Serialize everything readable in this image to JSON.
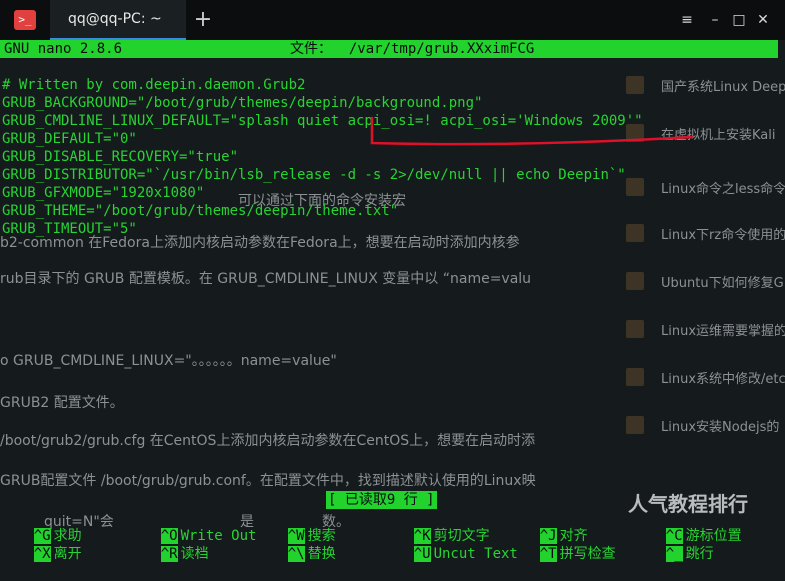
{
  "window": {
    "tab_title": "qq@qq-PC: ~",
    "new_tab_symbol": "+",
    "icons": [
      "terminal-icon",
      "new-tab-icon",
      "menu-icon",
      "minimize-icon",
      "maximize-icon",
      "close-icon"
    ],
    "controls": {
      "menu": "≡",
      "minimize": "–",
      "maximize": "□",
      "close": "✕"
    }
  },
  "nano": {
    "version": "GNU nano 2.8.6",
    "file_label": "文件：  /var/tmp/grub.XXximFCG",
    "lines": [
      "# Written by com.deepin.daemon.Grub2",
      "GRUB_BACKGROUND=\"/boot/grub/themes/deepin/background.png\"",
      "GRUB_CMDLINE_LINUX_DEFAULT=\"splash quiet acpi_osi=! acpi_osi='Windows 2009'\"",
      "GRUB_DEFAULT=\"0\"",
      "GRUB_DISABLE_RECOVERY=\"true\"",
      "GRUB_DISTRIBUTOR=\"`/usr/bin/lsb_release -d -s 2>/dev/null || echo Deepin`\"",
      "GRUB_GFXMODE=\"1920x1080\"",
      "GRUB_THEME=\"/boot/grub/themes/deepin/theme.txt\"",
      "GRUB_TIMEOUT=\"5\""
    ],
    "status": "[ 已读取9 行 ]",
    "shortcuts_row1": [
      {
        "key": "^G",
        "label": "求助"
      },
      {
        "key": "^O",
        "label": "Write Out"
      },
      {
        "key": "^W",
        "label": "搜索"
      },
      {
        "key": "^K",
        "label": "剪切文字"
      },
      {
        "key": "^J",
        "label": "对齐"
      },
      {
        "key": "^C",
        "label": "游标位置"
      }
    ],
    "shortcuts_row2": [
      {
        "key": "^X",
        "label": "离开"
      },
      {
        "key": "^R",
        "label": "读档"
      },
      {
        "key": "^\\",
        "label": "替换"
      },
      {
        "key": "^U",
        "label": "Uncut Text"
      },
      {
        "key": "^T",
        "label": "拼写检查"
      },
      {
        "key": "^_",
        "label": "跳行"
      }
    ]
  },
  "background_page": {
    "article_lines": [
      "可以通过下面的命令安装宏",
      "b2-common 在Fedora上添加内核启动参数在Fedora上，想要在启动时添加内核参",
      "rub目录下的 GRUB 配置模板。在 GRUB_CMDLINE_LINUX 变量中以 “name=valu",
      "o GRUB_CMDLINE_LINUX=\"。。。。。。name=value\"",
      "GRUB2 配置文件。",
      "/boot/grub2/grub.cfg 在CentOS上添加内核启动参数在CentOS上，想要在启动时添",
      "GRUB配置文件 /boot/grub/grub.conf。在配置文件中，找到描述默认使用的Linux映",
      "quit=N\"会",
      "是",
      "数。"
    ],
    "sidebar_items": [
      "国产系统Linux Deep",
      "在虚拟机上安装Kali",
      "Linux命令之less命令",
      "Linux下rz命令使用的",
      "Ubuntu下如何修复G",
      "Linux运维需要掌握的",
      "Linux系统中修改/etc",
      "Linux安装Nodejs的"
    ],
    "hot_title": "人气教程排行"
  },
  "colors": {
    "terminal_green": "#27d432",
    "bar_green": "#22d22d",
    "annotation_red": "#e0102a",
    "icon_red": "#e0413f",
    "tab_underline": "#3a8dde"
  }
}
